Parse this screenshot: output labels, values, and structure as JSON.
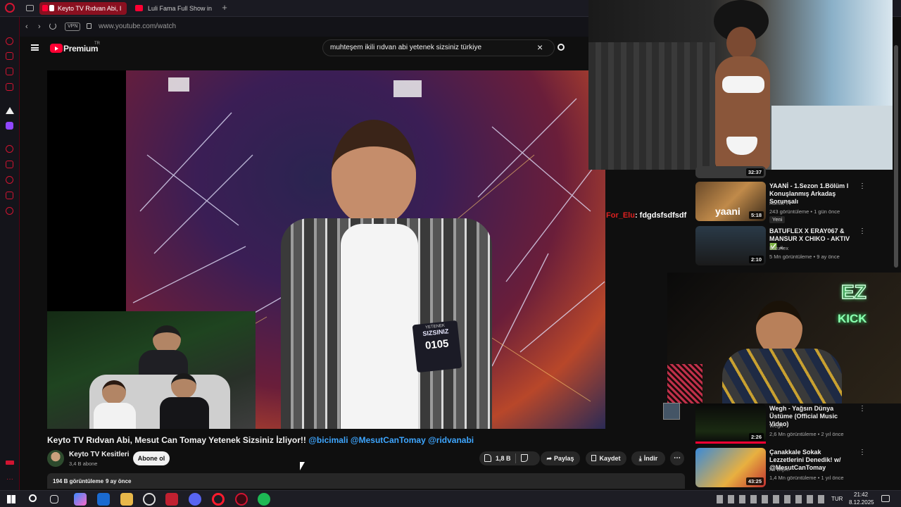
{
  "browser": {
    "tabs": [
      {
        "label": "Keyto TV Rıdvan Abi, I",
        "active": true
      },
      {
        "label": "Luli Fama Full Show in SLO",
        "active": false
      }
    ],
    "vpn_label": "VPN",
    "url": "www.youtube.com/watch"
  },
  "youtube": {
    "logo_text": "Premium",
    "logo_sup": "TR",
    "search_value": "muhteşem ikili rıdvan abi yetenek sizsiniz türkiye"
  },
  "video": {
    "badge_top": "YETENEK",
    "badge_mid": "SIZSINIZ",
    "badge_num": "0105",
    "title": "Keyto TV Rıdvan Abi, Mesut Can Tomay Yetenek Sizsiniz İzliyor!!",
    "title_links": "@bicimali @MesutCanTomay @ridvanabi",
    "channel_name": "Keyto TV Kesitleri",
    "subscribers": "3,4 B abone",
    "subscribe_label": "Abone ol",
    "like_count": "1,8 B",
    "share_label": "Paylaş",
    "save_label": "Kaydet",
    "download_label": "İndir",
    "views": "194 B görüntüleme",
    "age": "9 ay önce"
  },
  "chat": {
    "user": "For_Elu",
    "message": ": fdgdsfsdfsdf"
  },
  "webcam": {
    "sign_top": "EZ",
    "sign_bottom": "KICK"
  },
  "recommendations": [
    {
      "duration": "32:37"
    },
    {
      "title": "YAANİ - 1.Sezon 1.Bölüm I Konuşlanmış Arkadaş Sorunsalı",
      "channel": "Komik Tv",
      "meta": "243 görüntüleme • 1 gün önce",
      "badge": "Yeni",
      "duration": "5:18",
      "thumb_text": "yaani"
    },
    {
      "title": "BATUFLEX X ERAY067 & MANSUR X CHIKO - AKTIV ✅ ...",
      "channel": "Batuflex",
      "meta": "5 Mn görüntüleme • 9 ay önce",
      "duration": "2:10"
    },
    {
      "title": "Wegh - Yağsın Dünya Üstüme (Official Music Video)",
      "channel": "Wegh",
      "meta": "2,6 Mn görüntüleme • 2 yıl önce",
      "duration": "2:26"
    },
    {
      "title": "Çanakkale Sokak Lezzetlerini Denedik! w/ @MesutCanTomay",
      "channel": "Ali Biçim",
      "meta": "1,4 Mn görüntüleme • 1 yıl önce",
      "duration": "43:25"
    }
  ],
  "taskbar": {
    "lang": "TUR",
    "time": "21:42",
    "date": "8.12.2025"
  },
  "colors": {
    "accent": "#ff0033",
    "opera_red": "#d11431",
    "link_blue": "#3ea6ff"
  }
}
